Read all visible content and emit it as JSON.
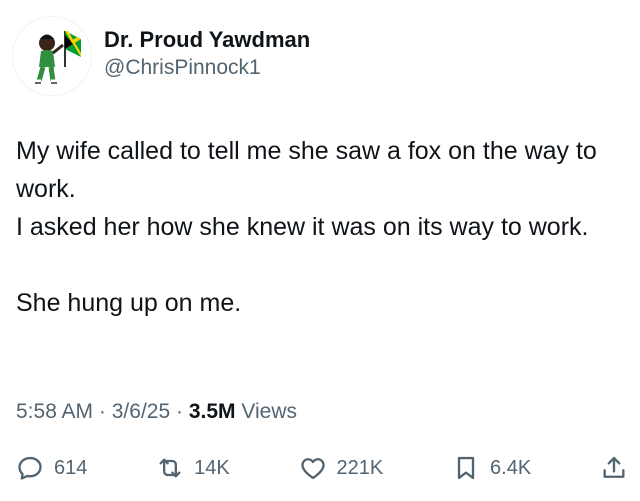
{
  "user": {
    "display_name": "Dr. Proud Yawdman",
    "handle": "@ChrisPinnock1",
    "avatar_icon": "cartoon-avatar-with-jamaican-flag"
  },
  "tweet": {
    "lines": [
      "My wife called to tell me she saw a fox on the way to work.",
      "I asked her how she knew it was on its way to work.",
      "She hung up on me."
    ]
  },
  "meta": {
    "time": "5:58 AM",
    "separator": "·",
    "date": "3/6/25",
    "views_count": "3.5M",
    "views_label": "Views"
  },
  "actions": {
    "replies": "614",
    "retweets": "14K",
    "likes": "221K",
    "bookmarks": "6.4K"
  },
  "colors": {
    "text_primary": "#0f1419",
    "text_secondary": "#536471",
    "jamaica_green": "#009b3a",
    "jamaica_yellow": "#fed100"
  }
}
